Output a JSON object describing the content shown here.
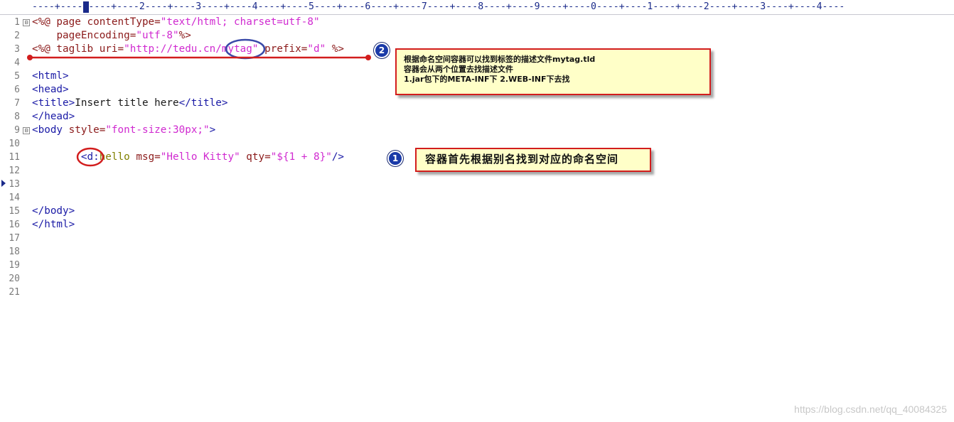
{
  "ruler": {
    "text": "----+----1----+----2----+----3----+----4----+----5----+----6----+----7----+----8----+----9----+----0----+----1----+----2----+----3----+----4----"
  },
  "gutter": {
    "line_numbers": [
      "1",
      "2",
      "3",
      "4",
      "5",
      "6",
      "7",
      "8",
      "9",
      "10",
      "11",
      "12",
      "13",
      "14",
      "15",
      "16",
      "17",
      "18",
      "19",
      "20",
      "21"
    ],
    "fold_glyph": "⊟"
  },
  "code": {
    "line1": {
      "open": "<%@",
      "kw": " page contentType=",
      "str1": "\"text/html; charset=utf-8\""
    },
    "line2": {
      "indent": "    ",
      "kw": "pageEncoding=",
      "str": "\"utf-8\"",
      "close": "%>"
    },
    "line3": {
      "open": "<%@",
      "kw": " taglib uri=",
      "q1": "\"",
      "url": "http://tedu.cn/",
      "ns": "mytag",
      "q2": "\"",
      "kw2": " prefix=",
      "str": "\"d\"",
      "close": " %>"
    },
    "line5": "<html>",
    "line6": "<head>",
    "line7": {
      "open": "<title>",
      "text": "Insert title here",
      "close": "</title>"
    },
    "line8": "</head>",
    "line9": {
      "open": "<body",
      "attr": " style=",
      "str": "\"font-size:30px;\"",
      "close": ">"
    },
    "line11": {
      "indent": "        ",
      "open": "<",
      "prefix": "d:",
      "tag": "hello",
      "attr1": " msg=",
      "str1": "\"Hello Kitty\"",
      "attr2": " qty=",
      "str2": "\"${1 + 8}\"",
      "close": "/>"
    },
    "line15": "</body>",
    "line16": "</html>"
  },
  "annotations": {
    "badge1": "1",
    "badge2": "2",
    "note1": "容器首先根据别名找到对应的命名空间",
    "note2": [
      "根据命名空间容器可以找到标签的描述文件mytag.tld",
      "容器会从两个位置去找描述文件",
      "1.jar包下的META-INF下  2.WEB-INF下去找"
    ]
  },
  "watermark": "https://blog.csdn.net/qq_40084325",
  "colors": {
    "directive": "#8b1a1a",
    "tag": "#1a1aa6",
    "string": "#d02ad0",
    "note_border": "#d21d1d",
    "note_bg": "#ffffc8",
    "badge": "#1a3aa8"
  }
}
